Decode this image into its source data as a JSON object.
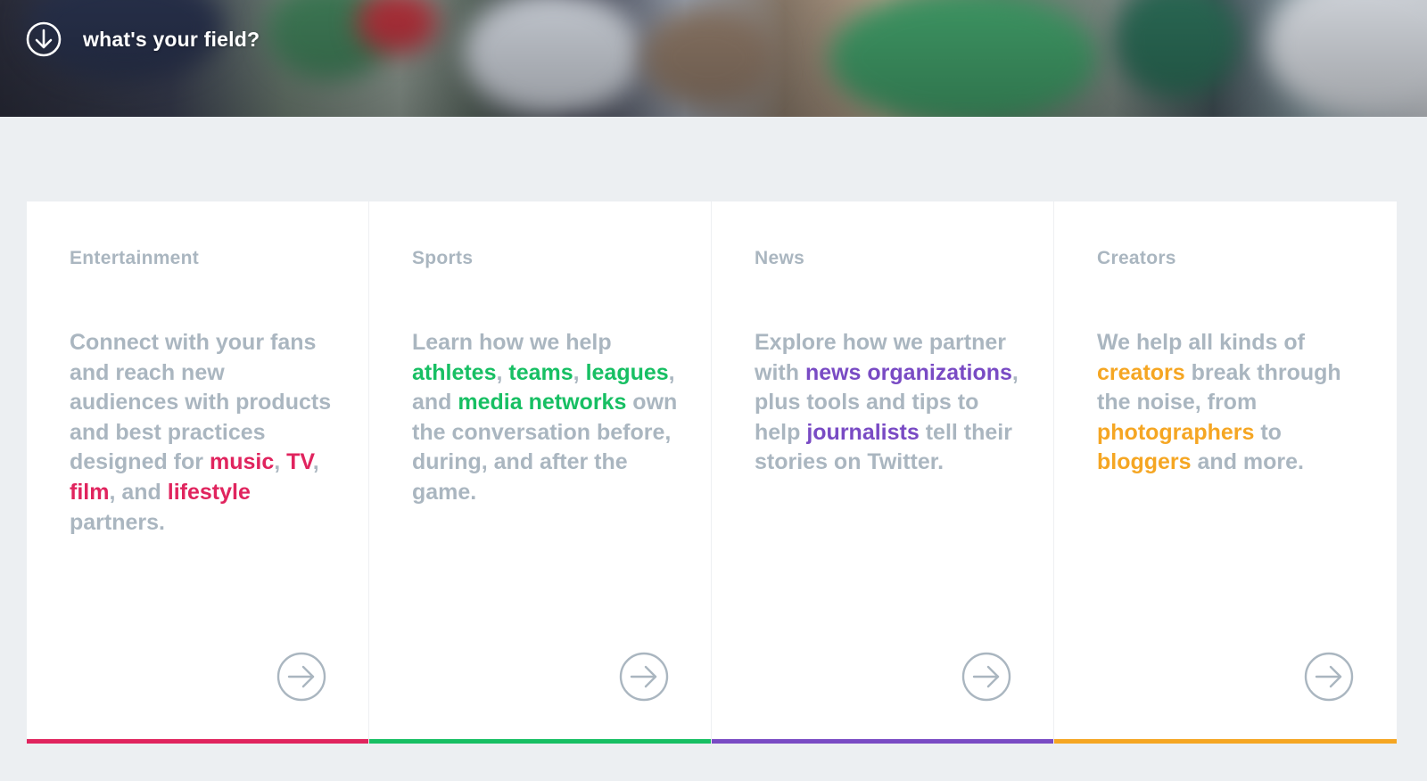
{
  "hero": {
    "title": "what's your field?",
    "icon": "arrow-down-circle-icon"
  },
  "colors": {
    "entertainment": "#e0245e",
    "sports": "#17bf63",
    "news": "#794bc4",
    "creators": "#f5a623",
    "muted_text": "#aab6c0"
  },
  "cards": [
    {
      "label": "Entertainment",
      "color": "#e0245e",
      "icon": "arrow-right-circle-icon",
      "description": [
        {
          "t": "Connect with your fans and reach new audiences with products and best practices designed for "
        },
        {
          "t": "music",
          "hl": true
        },
        {
          "t": ", "
        },
        {
          "t": "TV",
          "hl": true
        },
        {
          "t": ", "
        },
        {
          "t": "film",
          "hl": true
        },
        {
          "t": ", and "
        },
        {
          "t": "lifestyle",
          "hl": true
        },
        {
          "t": " partners."
        }
      ]
    },
    {
      "label": "Sports",
      "color": "#17bf63",
      "icon": "arrow-right-circle-icon",
      "description": [
        {
          "t": "Learn how we help "
        },
        {
          "t": "athletes",
          "hl": true
        },
        {
          "t": ", "
        },
        {
          "t": "teams",
          "hl": true
        },
        {
          "t": ", "
        },
        {
          "t": "leagues",
          "hl": true
        },
        {
          "t": ", and "
        },
        {
          "t": "media networks",
          "hl": true
        },
        {
          "t": " own the conversation before, during, and after the game."
        }
      ]
    },
    {
      "label": "News",
      "color": "#794bc4",
      "icon": "arrow-right-circle-icon",
      "description": [
        {
          "t": "Explore how we partner with "
        },
        {
          "t": "news organizations",
          "hl": true
        },
        {
          "t": ", plus tools and tips to help "
        },
        {
          "t": "journalists",
          "hl": true
        },
        {
          "t": " tell their stories on Twitter."
        }
      ]
    },
    {
      "label": "Creators",
      "color": "#f5a623",
      "icon": "arrow-right-circle-icon",
      "description": [
        {
          "t": "We help all kinds of "
        },
        {
          "t": "creators",
          "hl": true
        },
        {
          "t": " break through the noise, from "
        },
        {
          "t": "photographers",
          "hl": true
        },
        {
          "t": " to "
        },
        {
          "t": "bloggers",
          "hl": true
        },
        {
          "t": " and more."
        }
      ]
    }
  ]
}
